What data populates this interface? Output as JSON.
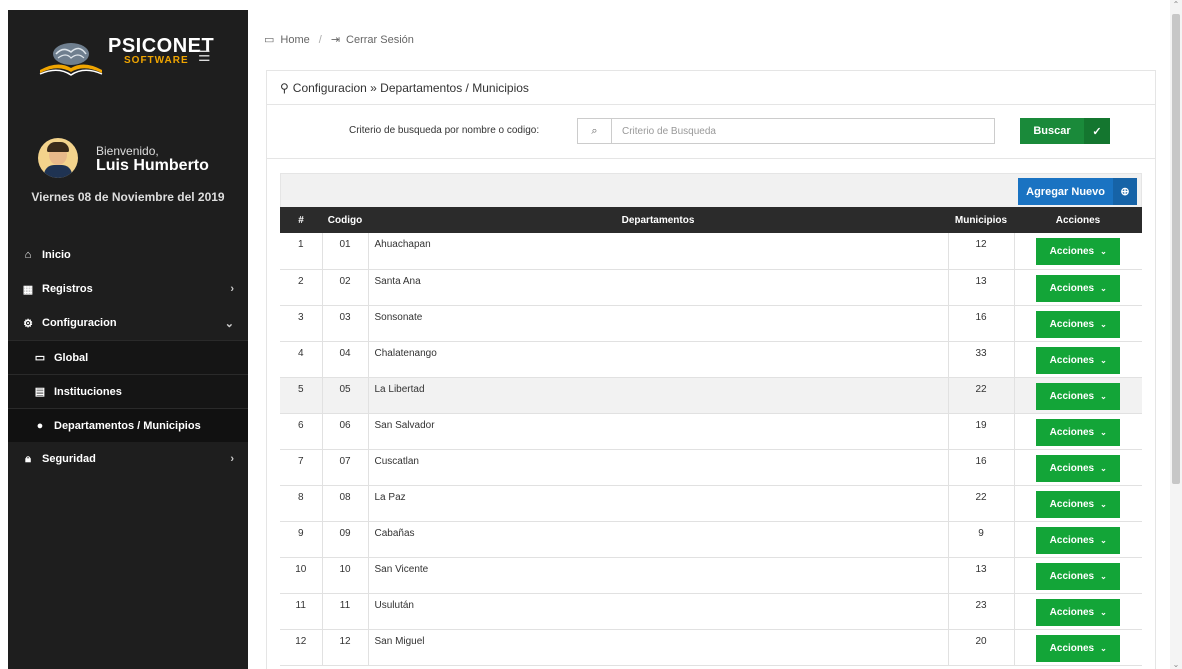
{
  "logo": {
    "name": "PSICONET",
    "sub": "SOFTWARE"
  },
  "user": {
    "welcome": "Bienvenido,",
    "name": "Luis Humberto",
    "date": "Viernes 08 de Noviembre del 2019"
  },
  "menu": {
    "inicio": "Inicio",
    "registros": "Registros",
    "configuracion": "Configuracion",
    "global": "Global",
    "instituciones": "Instituciones",
    "departamentos": "Departamentos / Municipios",
    "seguridad": "Seguridad"
  },
  "breadcrumb": {
    "home": "Home",
    "logout": "Cerrar Sesión"
  },
  "panel": {
    "title": "Configuracion » Departamentos / Municipios"
  },
  "search": {
    "label": "Criterio de busqueda por nombre o codigo:",
    "placeholder": "Criterio de Busqueda",
    "button": "Buscar"
  },
  "add_button": "Agregar Nuevo",
  "table": {
    "headers": [
      "#",
      "Codigo",
      "Departamentos",
      "Municipios",
      "Acciones"
    ],
    "action_label": "Acciones",
    "rows": [
      {
        "n": "1",
        "code": "01",
        "dep": "Ahuachapan",
        "mun": "12"
      },
      {
        "n": "2",
        "code": "02",
        "dep": "Santa Ana",
        "mun": "13"
      },
      {
        "n": "3",
        "code": "03",
        "dep": "Sonsonate",
        "mun": "16"
      },
      {
        "n": "4",
        "code": "04",
        "dep": "Chalatenango",
        "mun": "33"
      },
      {
        "n": "5",
        "code": "05",
        "dep": "La Libertad",
        "mun": "22"
      },
      {
        "n": "6",
        "code": "06",
        "dep": "San Salvador",
        "mun": "19"
      },
      {
        "n": "7",
        "code": "07",
        "dep": "Cuscatlan",
        "mun": "16"
      },
      {
        "n": "8",
        "code": "08",
        "dep": "La Paz",
        "mun": "22"
      },
      {
        "n": "9",
        "code": "09",
        "dep": "Cabañas",
        "mun": "9"
      },
      {
        "n": "10",
        "code": "10",
        "dep": "San Vicente",
        "mun": "13"
      },
      {
        "n": "11",
        "code": "11",
        "dep": "Usulután",
        "mun": "23"
      },
      {
        "n": "12",
        "code": "12",
        "dep": "San Miguel",
        "mun": "20"
      }
    ]
  },
  "colors": {
    "sidebar": "#1e1e1e",
    "green": "#13a538",
    "blue": "#1a73c2",
    "header": "#2b2b2b"
  }
}
